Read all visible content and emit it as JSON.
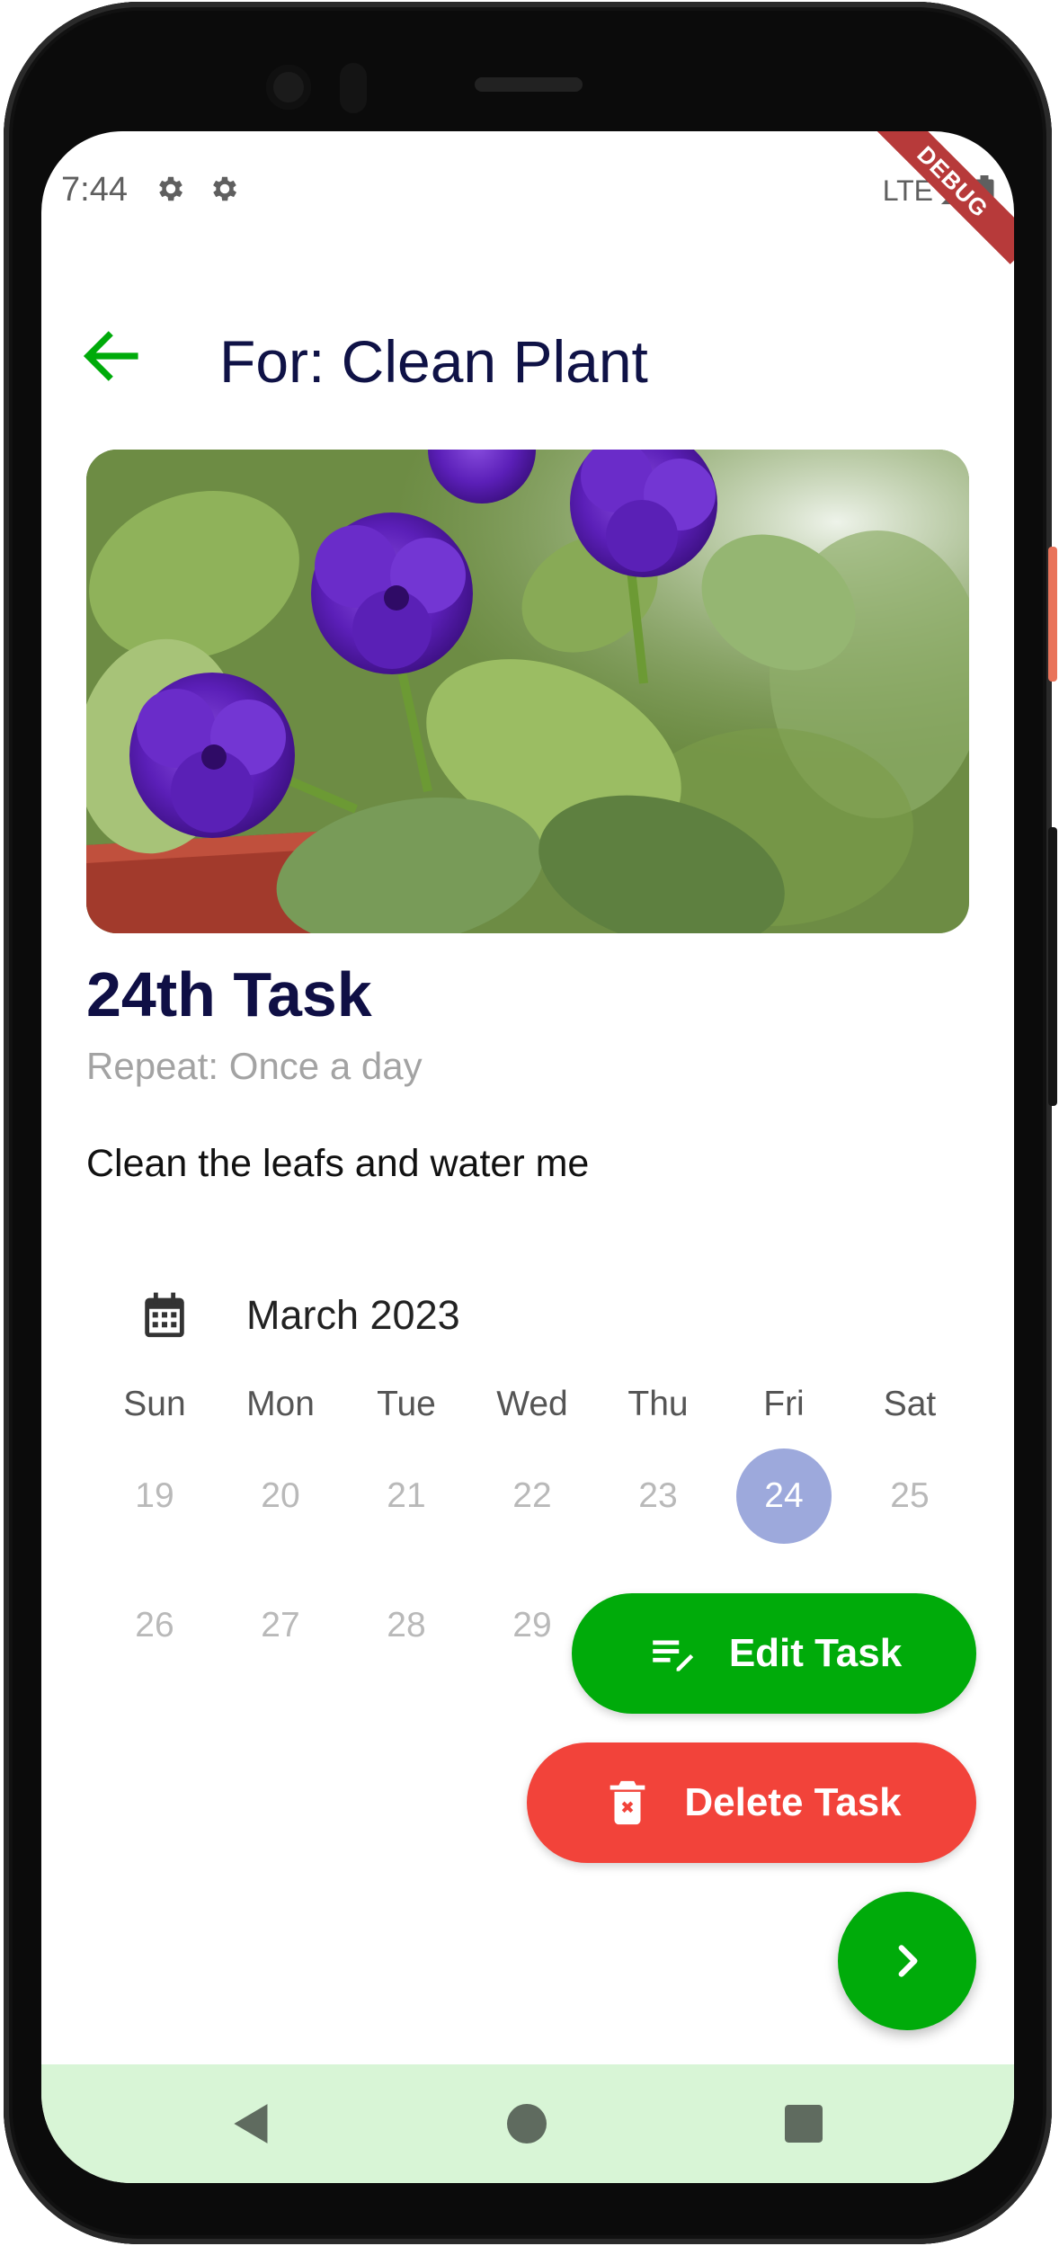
{
  "status_bar": {
    "time": "7:44",
    "network": "LTE",
    "icons": [
      "settings-icon",
      "settings-icon",
      "signal-icon",
      "battery-icon"
    ],
    "debug_banner": "DEBUG"
  },
  "app_bar": {
    "title": "For: Clean Plant",
    "back_icon": "arrow-back-icon"
  },
  "hero_image": {
    "subject": "purple flowers in pot"
  },
  "task": {
    "title": "24th Task",
    "repeat": "Repeat: Once a day",
    "description": "Clean the leafs and water me"
  },
  "calendar": {
    "icon": "calendar-icon",
    "month": "March 2023",
    "weekdays": [
      "Sun",
      "Mon",
      "Tue",
      "Wed",
      "Thu",
      "Fri",
      "Sat"
    ],
    "week1": [
      "19",
      "20",
      "21",
      "22",
      "23",
      "24",
      "25"
    ],
    "week2": [
      "26",
      "27",
      "28",
      "29"
    ],
    "selected_day": "24"
  },
  "actions": {
    "edit_label": "Edit Task",
    "delete_label": "Delete Task",
    "next_icon": "chevron-right-icon"
  },
  "nav_bar": {
    "icons": [
      "back-triangle-icon",
      "home-circle-icon",
      "recents-square-icon"
    ]
  },
  "colors": {
    "primary_green": "#00ab0a",
    "delete_red": "#f2433a",
    "title_navy": "#0f1246",
    "selected_day": "#9da9dc",
    "nav_bar_bg": "#d8f5d6"
  }
}
